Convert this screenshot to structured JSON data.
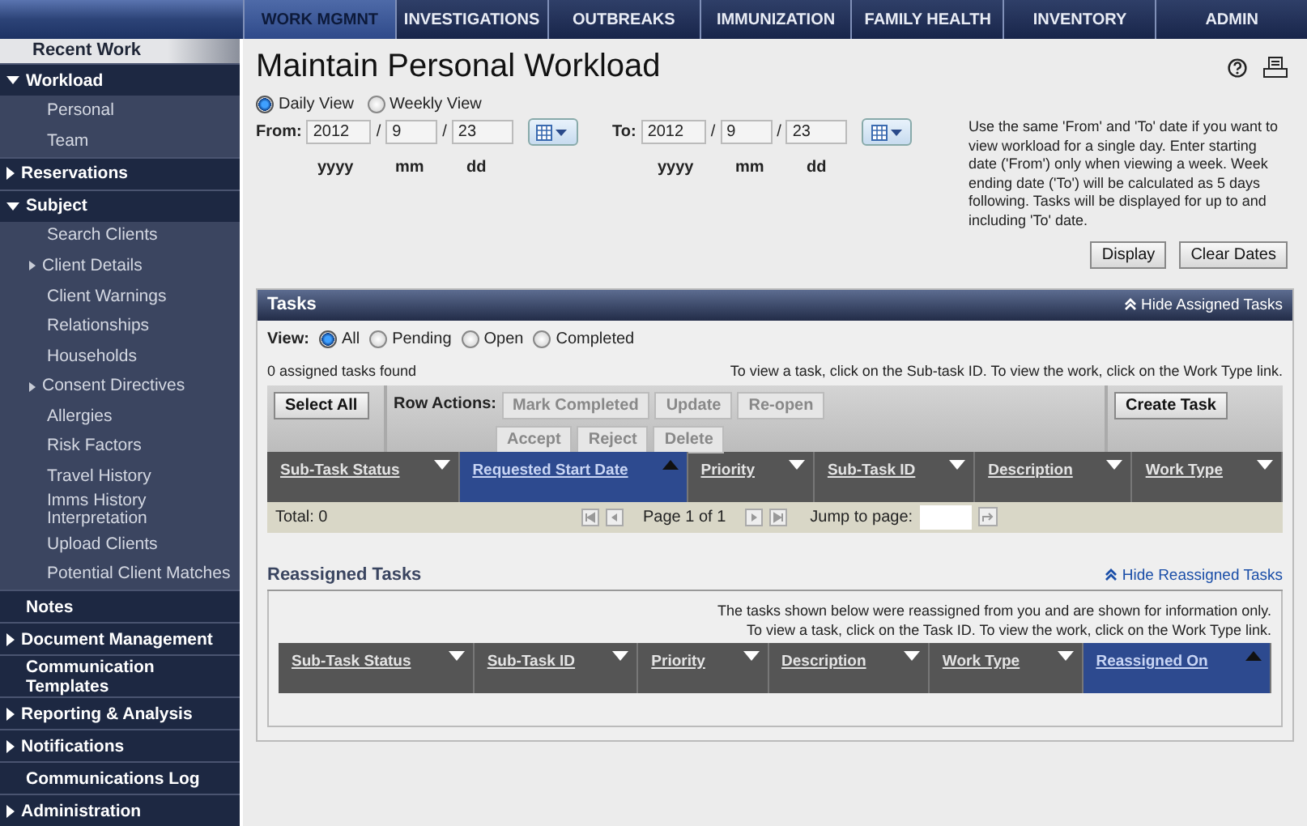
{
  "top_nav": {
    "tabs": [
      {
        "label": "WORK MGMNT",
        "selected": true
      },
      {
        "label": "INVESTIGATIONS",
        "selected": false
      },
      {
        "label": "OUTBREAKS",
        "selected": false
      },
      {
        "label": "IMMUNIZATION",
        "selected": false
      },
      {
        "label": "FAMILY HEALTH",
        "selected": false
      },
      {
        "label": "INVENTORY",
        "selected": false
      },
      {
        "label": "ADMIN",
        "selected": false
      }
    ]
  },
  "sidebar": {
    "recent": "Recent Work",
    "sections": [
      {
        "label": "Workload",
        "kind": "folder",
        "expanded": true,
        "children": [
          {
            "label": "Personal",
            "kind": "link"
          },
          {
            "label": "Team",
            "kind": "link"
          }
        ]
      },
      {
        "label": "Reservations",
        "kind": "folder",
        "expanded": false
      },
      {
        "label": "Subject",
        "kind": "folder",
        "expanded": true,
        "children": [
          {
            "label": "Search Clients",
            "kind": "link"
          },
          {
            "label": "Client Details",
            "kind": "folder",
            "expanded": false
          },
          {
            "label": "Client Warnings",
            "kind": "link"
          },
          {
            "label": "Relationships",
            "kind": "link"
          },
          {
            "label": "Households",
            "kind": "link"
          },
          {
            "label": "Consent Directives",
            "kind": "folder",
            "expanded": false
          },
          {
            "label": "Allergies",
            "kind": "link"
          },
          {
            "label": "Risk Factors",
            "kind": "link"
          },
          {
            "label": "Travel History",
            "kind": "link"
          },
          {
            "label": "Imms History Interpretation",
            "kind": "link"
          },
          {
            "label": "Upload Clients",
            "kind": "link"
          },
          {
            "label": "Potential Client Matches",
            "kind": "link"
          }
        ]
      },
      {
        "label": "Notes",
        "kind": "link"
      },
      {
        "label": "Document Management",
        "kind": "folder",
        "expanded": false
      },
      {
        "label": "Communication Templates",
        "kind": "link"
      },
      {
        "label": "Reporting & Analysis",
        "kind": "folder",
        "expanded": false
      },
      {
        "label": "Notifications",
        "kind": "folder",
        "expanded": false
      },
      {
        "label": "Communications Log",
        "kind": "link"
      },
      {
        "label": "Administration",
        "kind": "folder",
        "expanded": false
      }
    ]
  },
  "page": {
    "title": "Maintain Personal Workload"
  },
  "view_mode": [
    {
      "label": "Daily View",
      "selected": true
    },
    {
      "label": "Weekly View",
      "selected": false
    }
  ],
  "date_range": [
    {
      "label": "From:",
      "parts": [
        {
          "value": "2012",
          "unit": "yyyy"
        },
        {
          "separator": "/",
          "value": "9",
          "unit": "mm"
        },
        {
          "separator": "/",
          "value": "23",
          "unit": "dd"
        }
      ]
    },
    {
      "label": "To:",
      "parts": [
        {
          "value": "2012",
          "unit": "yyyy"
        },
        {
          "separator": "/",
          "value": "9",
          "unit": "mm"
        },
        {
          "separator": "/",
          "value": "23",
          "unit": "dd"
        }
      ]
    }
  ],
  "help_text": "Use the same 'From' and 'To' date if you want to view workload for a single day. Enter starting date ('From') only when viewing a week. Week ending date ('To') will be calculated as 5 days following. Tasks will be displayed for up to and including 'To' date.",
  "date_buttons": [
    "Display",
    "Clear Dates"
  ],
  "tasks": {
    "title": "Tasks",
    "hide_link": "Hide Assigned Tasks",
    "view_label": "View:",
    "filters": [
      {
        "label": "All",
        "selected": true
      },
      {
        "label": "Pending",
        "selected": false
      },
      {
        "label": "Open",
        "selected": false
      },
      {
        "label": "Completed",
        "selected": false
      }
    ],
    "count": "0 assigned tasks found",
    "hint": "To view a task, click on the Sub-task ID. To view the work, click on the Work Type link.",
    "select_all": "Select All",
    "row_actions_label": "Row Actions:",
    "row_actions": [
      [
        {
          "label": "Mark Completed",
          "disabled": true
        },
        {
          "label": "Update",
          "disabled": true
        },
        {
          "label": "Re-open",
          "disabled": true
        }
      ],
      [
        {
          "label": "Accept",
          "disabled": true
        },
        {
          "label": "Reject",
          "disabled": true
        },
        {
          "label": "Delete",
          "disabled": true
        }
      ]
    ],
    "create": "Create Task",
    "columns": [
      {
        "label": "Sub-Task Status",
        "selected": false
      },
      {
        "label": "Requested Start Date",
        "selected": true
      },
      {
        "label": "Priority",
        "selected": false
      },
      {
        "label": "Sub-Task ID",
        "selected": false
      },
      {
        "label": "Description",
        "selected": false
      },
      {
        "label": "Work Type",
        "selected": false
      }
    ],
    "total": "Total: 0",
    "page_info": "Page 1 of 1",
    "jump_label": "Jump to page:"
  },
  "reassigned": {
    "title": "Reassigned Tasks",
    "hide_link": "Hide Reassigned Tasks",
    "notes": [
      "The tasks shown below were reassigned from you and are shown for information only.",
      "To view a task, click on the Task ID. To view the work, click on the Work Type link."
    ],
    "columns": [
      {
        "label": "Sub-Task Status",
        "selected": false
      },
      {
        "label": "Sub-Task ID",
        "selected": false
      },
      {
        "label": "Priority",
        "selected": false
      },
      {
        "label": "Description",
        "selected": false
      },
      {
        "label": "Work Type",
        "selected": false
      },
      {
        "label": "Reassigned On",
        "selected": true
      }
    ]
  }
}
